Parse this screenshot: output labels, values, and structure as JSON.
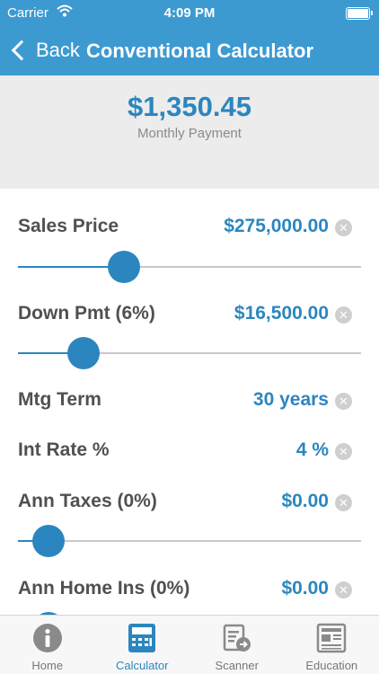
{
  "status_bar": {
    "carrier": "Carrier",
    "time": "4:09 PM"
  },
  "nav": {
    "back_label": "Back",
    "title": "Conventional Calculator"
  },
  "summary": {
    "amount": "$1,350.45",
    "caption": "Monthly Payment"
  },
  "fields": [
    {
      "label": "Sales Price",
      "value": "$275,000.00",
      "slider_level": 0.31
    },
    {
      "label": "Down Pmt (6%)",
      "value": "$16,500.00",
      "slider_level": 0.19
    },
    {
      "label": "Mtg Term",
      "value": "30 years"
    },
    {
      "label": "Int Rate %",
      "value": "4 %"
    },
    {
      "label": "Ann Taxes (0%)",
      "value": "$0.00",
      "slider_level": 0.09
    },
    {
      "label": "Ann Home Ins (0%)",
      "value": "$0.00",
      "slider_level": 0.09
    }
  ],
  "clear_glyph": "✕",
  "tabs": [
    {
      "label": "Home",
      "icon": "info-icon"
    },
    {
      "label": "Calculator",
      "icon": "calculator-icon",
      "active": true
    },
    {
      "label": "Scanner",
      "icon": "scanner-icon"
    },
    {
      "label": "Education",
      "icon": "newspaper-icon"
    }
  ],
  "colors": {
    "brand": "#3d9ad1",
    "accent": "#2b86bf",
    "label": "#505050"
  }
}
